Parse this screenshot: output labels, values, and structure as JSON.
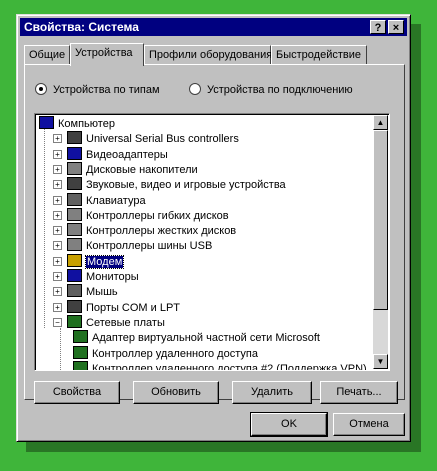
{
  "window": {
    "title": "Свойства: Система",
    "help_glyph": "?",
    "close_glyph": "×"
  },
  "tabs": [
    {
      "label": "Общие"
    },
    {
      "label": "Устройства"
    },
    {
      "label": "Профили оборудования"
    },
    {
      "label": "Быстродействие"
    }
  ],
  "view_options": {
    "by_type": "Устройства по типам",
    "by_connection": "Устройства по подключению",
    "selected": "by_type"
  },
  "tree": [
    {
      "label": "Компьютер",
      "icon": "computer-icon",
      "level": 0
    },
    {
      "label": "Universal Serial Bus controllers",
      "icon": "usb-icon",
      "level": 1,
      "expander": "+"
    },
    {
      "label": "Видеоадаптеры",
      "icon": "monitor-icon",
      "level": 1,
      "expander": "+"
    },
    {
      "label": "Дисковые накопители",
      "icon": "disk-drive-icon",
      "level": 1,
      "expander": "+"
    },
    {
      "label": "Звуковые, видео и игровые устройства",
      "icon": "speaker-icon",
      "level": 1,
      "expander": "+"
    },
    {
      "label": "Клавиатура",
      "icon": "keyboard-icon",
      "level": 1,
      "expander": "+"
    },
    {
      "label": "Контроллеры гибких дисков",
      "icon": "floppy-controller-icon",
      "level": 1,
      "expander": "+"
    },
    {
      "label": "Контроллеры жестких дисков",
      "icon": "hdd-controller-icon",
      "level": 1,
      "expander": "+"
    },
    {
      "label": "Контроллеры шины USB",
      "icon": "usb-controller-icon",
      "level": 1,
      "expander": "+"
    },
    {
      "label": "Модем",
      "icon": "modem-icon",
      "level": 1,
      "expander": "+",
      "selected": true
    },
    {
      "label": "Мониторы",
      "icon": "monitor-icon",
      "level": 1,
      "expander": "+"
    },
    {
      "label": "Мышь",
      "icon": "mouse-icon",
      "level": 1,
      "expander": "+"
    },
    {
      "label": "Порты COM и LPT",
      "icon": "port-icon",
      "level": 1,
      "expander": "+"
    },
    {
      "label": "Сетевые платы",
      "icon": "network-card-icon",
      "level": 1,
      "expander": "−"
    },
    {
      "label": "Адаптер виртуальной частной сети Microsoft",
      "icon": "network-card-icon",
      "level": 2
    },
    {
      "label": "Контроллер удаленного доступа",
      "icon": "network-card-icon",
      "level": 2
    },
    {
      "label": "Контроллер удаленного доступа #2 (Поддержка VPN)",
      "icon": "network-card-icon",
      "level": 2
    }
  ],
  "buttons": {
    "properties": "Свойства",
    "refresh": "Обновить",
    "remove": "Удалить",
    "print": "Печать...",
    "ok": "OK",
    "cancel": "Отмена"
  },
  "colors": {
    "titlebar": "#000080",
    "face": "#c0c0c0",
    "selection": "#000080",
    "background": "#3fb53a"
  }
}
